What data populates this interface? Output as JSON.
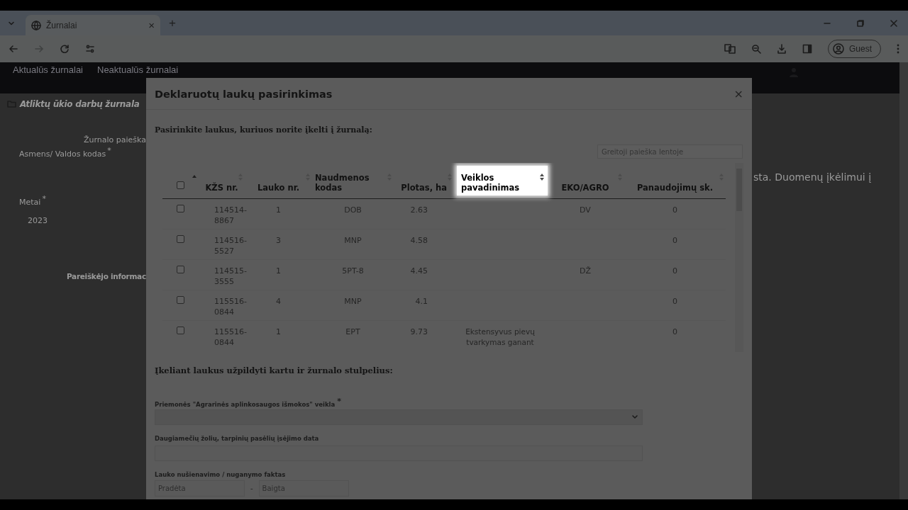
{
  "browser": {
    "tab": {
      "title": "Žurnalai",
      "close": "×"
    },
    "new_tab": "+",
    "profile": "Guest"
  },
  "navbar": {
    "items": [
      {
        "label": "Aktualūs žurnalai"
      },
      {
        "label": "Neaktualūs žurnalai"
      }
    ]
  },
  "background_page": {
    "heading": "Atliktų ūkio darbų žurnala",
    "search_title": "Žurnalo paieška",
    "fields": [
      {
        "label": "Asmens/ Valdos kodas",
        "mark": "*"
      },
      {
        "label": "Metai",
        "mark": "*",
        "value": "2023"
      }
    ],
    "section": "Pareiškėjo informac",
    "notice": "sta. Duomenų įkėlimui į"
  },
  "modal": {
    "title": "Deklaruotų laukų pasirinkimas",
    "close": "×",
    "intro": "Pasirinkite laukus, kuriuos norite įkelti į žurnalą:",
    "search": {
      "placeholder": "Greitoji paieška lentoje"
    },
    "table": {
      "select_all": {
        "checked": false,
        "sorted": true
      },
      "columns": [
        {
          "label": "KŽS nr.",
          "sorted": false,
          "highlighted": false
        },
        {
          "label": "Lauko nr.",
          "sorted": false,
          "highlighted": false
        },
        {
          "label": "Naudmenos kodas",
          "sorted": false,
          "highlighted": false
        },
        {
          "label": "Plotas, ha",
          "sorted": false,
          "highlighted": false
        },
        {
          "label": "Veiklos pavadinimas",
          "sorted": false,
          "highlighted": true
        },
        {
          "label": "EKO/AGRO",
          "sorted": false,
          "highlighted": false
        },
        {
          "label": "Panaudojimų sk.",
          "sorted": false,
          "highlighted": false
        }
      ],
      "rows": [
        {
          "checked": false,
          "cells": [
            "114514-8867",
            "1",
            "DOB",
            "2.63",
            "",
            "DV",
            "0"
          ]
        },
        {
          "checked": false,
          "cells": [
            "114516-5527",
            "3",
            "MNP",
            "4.58",
            "",
            "",
            "0"
          ]
        },
        {
          "checked": false,
          "cells": [
            "114515-3555",
            "1",
            "5PT-8",
            "4.45",
            "",
            "DŽ",
            "0"
          ]
        },
        {
          "checked": false,
          "cells": [
            "115516-0844",
            "4",
            "MNP",
            "4.1",
            "",
            "",
            "0"
          ]
        },
        {
          "checked": false,
          "cells": [
            "115516-0844",
            "1",
            "EPT",
            "9.73",
            "Ekstensyvus pievų tvarkymas ganant",
            "",
            "0"
          ]
        }
      ]
    },
    "form": {
      "heading": "Įkeliant laukus užpildyti kartu ir žurnalo stulpelius:",
      "fields": [
        {
          "kind": "select",
          "label": "Priemonės \"Agrarinės aplinkosaugos išmokos\" veikla",
          "mark": "*"
        },
        {
          "kind": "text",
          "label": "Daugiamečių žolių, tarpinių pasėlių įsėjimo data"
        },
        {
          "kind": "range",
          "label": "Lauko nušienavimo / nuganymo faktas",
          "from_placeholder": "Pradėta",
          "separator": "-",
          "to_placeholder": "Baigta"
        }
      ]
    }
  }
}
